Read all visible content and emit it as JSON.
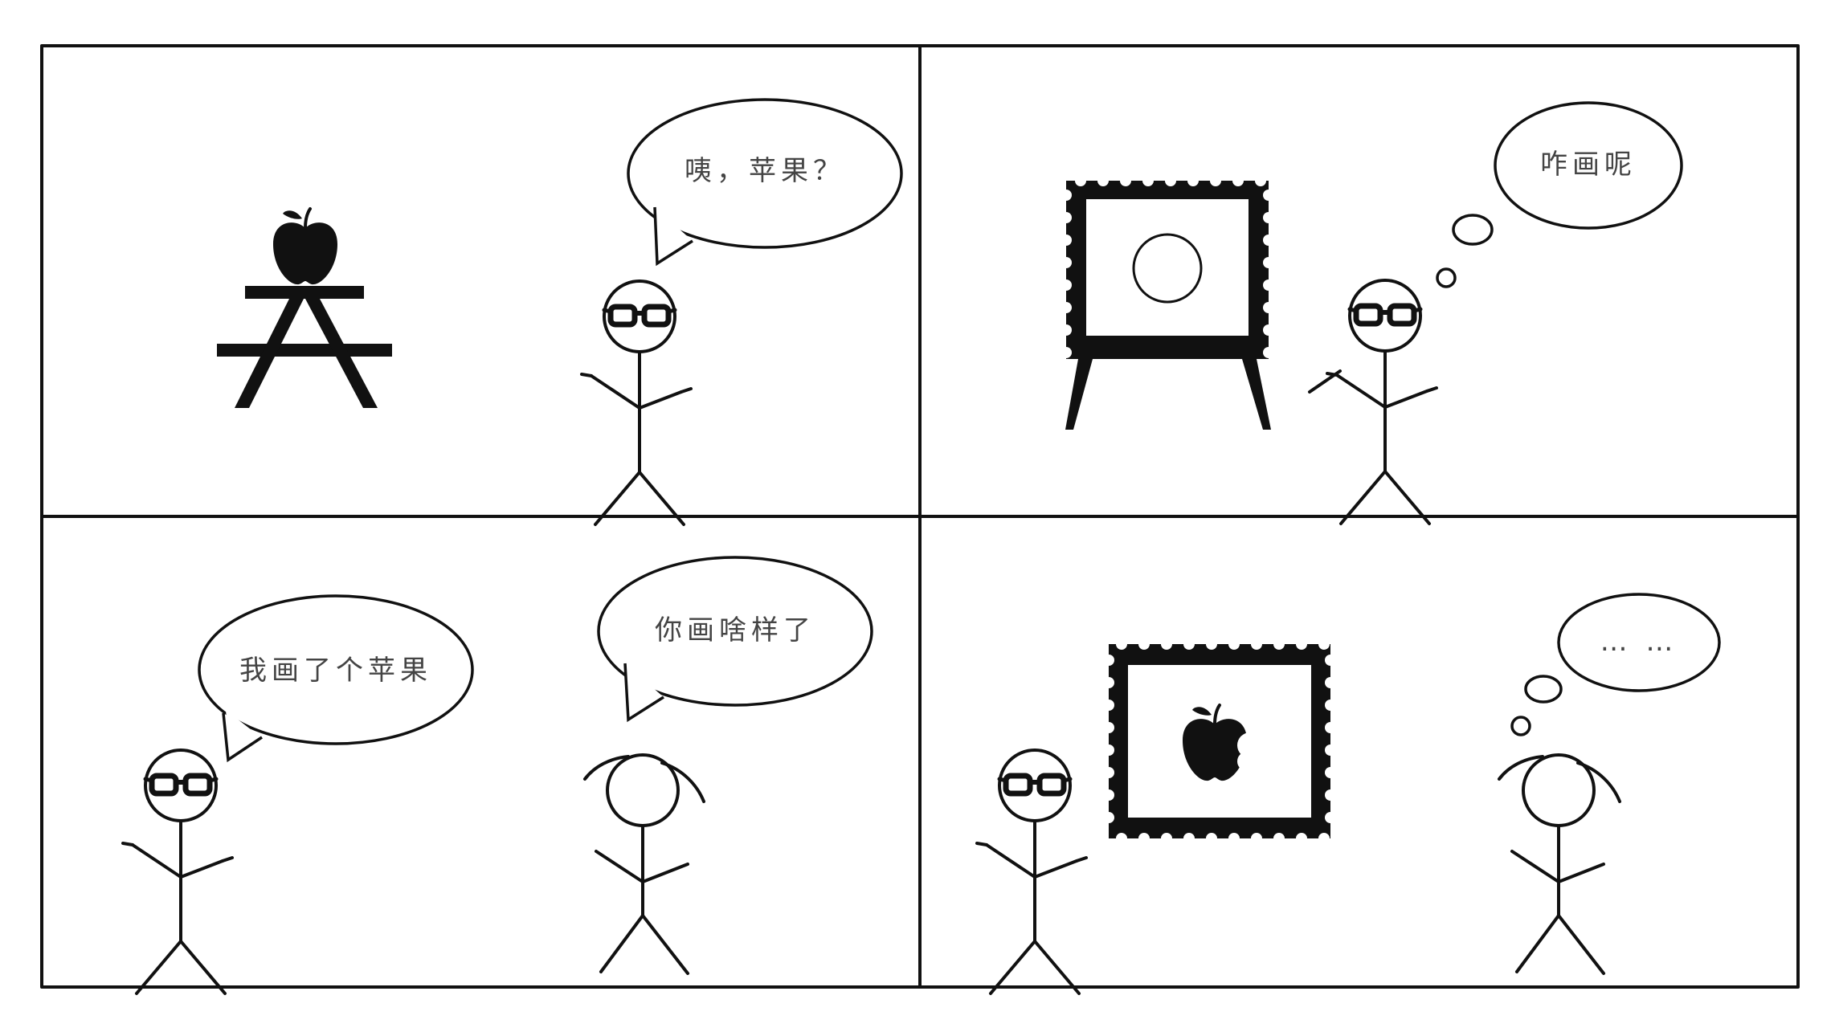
{
  "comic": {
    "panel1": {
      "speech": "咦，苹果？"
    },
    "panel2": {
      "thought": "咋画呢"
    },
    "panel3": {
      "speech_left": "我画了个苹果",
      "speech_right": "你画啥样了"
    },
    "panel4": {
      "thought": "… …"
    }
  },
  "colors": {
    "ink": "#111111",
    "paper": "#ffffff",
    "text": "#444444"
  },
  "icons": [
    "apple-icon",
    "table-icon",
    "easel-icon",
    "stamp-frame-icon",
    "bitten-apple-icon",
    "glasses-icon"
  ]
}
